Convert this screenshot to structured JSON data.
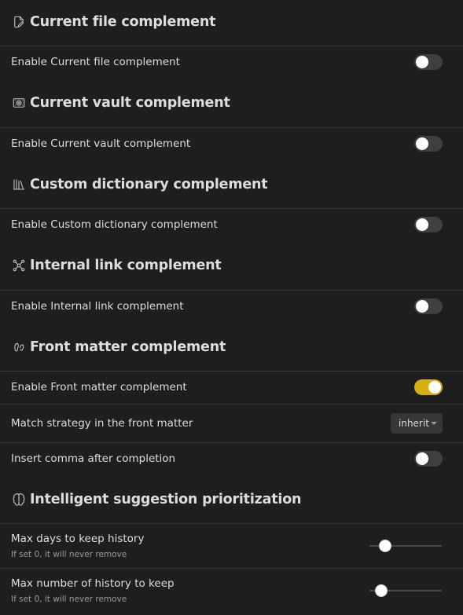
{
  "sections": [
    {
      "title": "Current file complement",
      "icon": "file-pen-icon",
      "rows": [
        {
          "label": "Enable Current file complement",
          "control": "toggle",
          "value": false
        }
      ]
    },
    {
      "title": "Current vault complement",
      "icon": "vault-icon",
      "rows": [
        {
          "label": "Enable Current vault complement",
          "control": "toggle",
          "value": false
        }
      ]
    },
    {
      "title": "Custom dictionary complement",
      "icon": "library-icon",
      "rows": [
        {
          "label": "Enable Custom dictionary complement",
          "control": "toggle",
          "value": false
        }
      ]
    },
    {
      "title": "Internal link complement",
      "icon": "network-icon",
      "rows": [
        {
          "label": "Enable Internal link complement",
          "control": "toggle",
          "value": false
        }
      ]
    },
    {
      "title": "Front matter complement",
      "icon": "footprints-icon",
      "rows": [
        {
          "label": "Enable Front matter complement",
          "control": "toggle",
          "value": true
        },
        {
          "label": "Match strategy in the front matter",
          "control": "dropdown",
          "value": "inherit"
        },
        {
          "label": "Insert comma after completion",
          "control": "toggle",
          "value": false
        }
      ]
    },
    {
      "title": "Intelligent suggestion prioritization",
      "icon": "brain-icon",
      "rows": [
        {
          "label": "Max days to keep history",
          "description": "If set 0, it will never remove",
          "control": "slider",
          "value": 0.16
        },
        {
          "label": "Max number of history to keep",
          "description": "If set 0, it will never remove",
          "control": "slider",
          "value": 0.09
        }
      ]
    }
  ],
  "colors": {
    "background": "#1e1e1e",
    "divider": "#363636",
    "toggle_off": "#3f3f3f",
    "toggle_on": "#d4af0f",
    "text": "#dcddde",
    "muted_text": "#999999"
  }
}
